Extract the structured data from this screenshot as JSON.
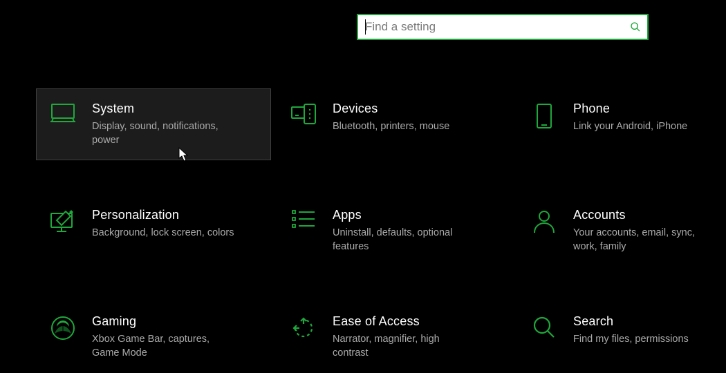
{
  "search": {
    "placeholder": "Find a setting"
  },
  "accent": "#1fa83c",
  "tiles": [
    {
      "id": "system",
      "title": "System",
      "desc": "Display, sound, notifications, power"
    },
    {
      "id": "devices",
      "title": "Devices",
      "desc": "Bluetooth, printers, mouse"
    },
    {
      "id": "phone",
      "title": "Phone",
      "desc": "Link your Android, iPhone"
    },
    {
      "id": "personalization",
      "title": "Personalization",
      "desc": "Background, lock screen, colors"
    },
    {
      "id": "apps",
      "title": "Apps",
      "desc": "Uninstall, defaults, optional features"
    },
    {
      "id": "accounts",
      "title": "Accounts",
      "desc": "Your accounts, email, sync, work, family"
    },
    {
      "id": "gaming",
      "title": "Gaming",
      "desc": "Xbox Game Bar, captures, Game Mode"
    },
    {
      "id": "ease-of-access",
      "title": "Ease of Access",
      "desc": "Narrator, magnifier, high contrast"
    },
    {
      "id": "search",
      "title": "Search",
      "desc": "Find my files, permissions"
    }
  ]
}
